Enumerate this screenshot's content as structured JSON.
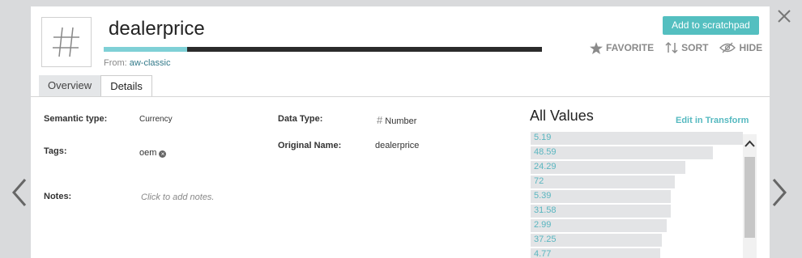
{
  "column": {
    "name": "dealerprice",
    "from_label": "From:",
    "source": "aw-classic",
    "completeness": 0.19
  },
  "header": {
    "scratchpad_button": "Add to scratchpad",
    "favorite": "FAVORITE",
    "sort": "SORT",
    "hide": "HIDE"
  },
  "tabs": [
    {
      "label": "Overview",
      "active": false
    },
    {
      "label": "Details",
      "active": true
    }
  ],
  "details": {
    "semantic_type_label": "Semantic type:",
    "semantic_type_value": "Currency",
    "data_type_label": "Data Type:",
    "data_type_value": "Number",
    "tags_label": "Tags:",
    "tag_value": "oem",
    "original_name_label": "Original Name:",
    "original_name_value": "dealerprice",
    "notes_label": "Notes:",
    "notes_placeholder": "Click to add notes."
  },
  "all_values": {
    "title": "All Values",
    "edit_link": "Edit in Transform",
    "items": [
      {
        "value": "5.19",
        "frequency": 1.0
      },
      {
        "value": "48.59",
        "frequency": 0.86
      },
      {
        "value": "24.29",
        "frequency": 0.73
      },
      {
        "value": "72",
        "frequency": 0.68
      },
      {
        "value": "5.39",
        "frequency": 0.66
      },
      {
        "value": "31.58",
        "frequency": 0.66
      },
      {
        "value": "2.99",
        "frequency": 0.64
      },
      {
        "value": "37.25",
        "frequency": 0.62
      },
      {
        "value": "4.77",
        "frequency": 0.61
      }
    ]
  },
  "colors": {
    "accent": "#54bfc0",
    "bar_fill": "#7fd0d6",
    "value_text": "#5ab6c0"
  }
}
